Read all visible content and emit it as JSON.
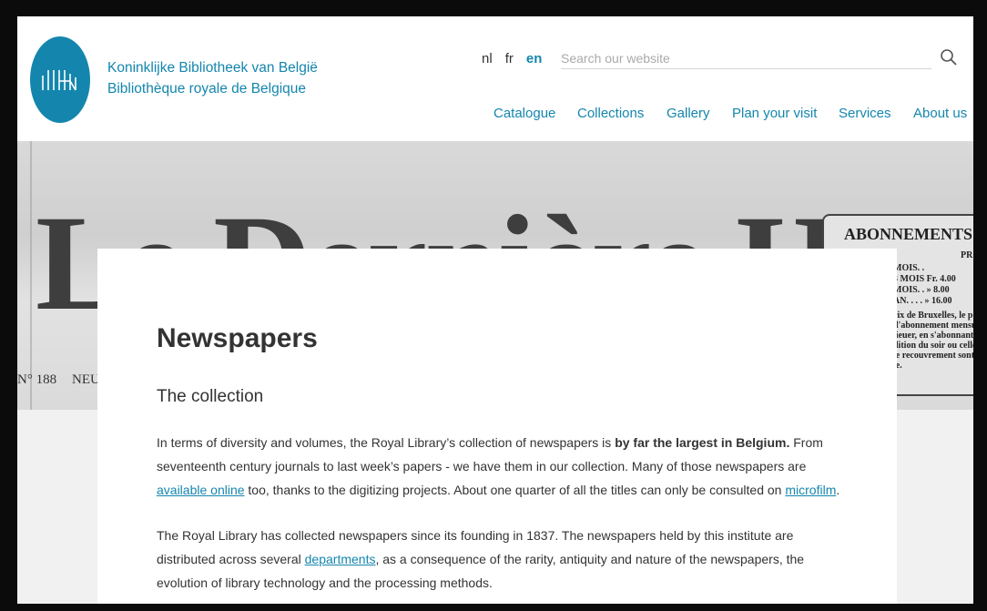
{
  "header": {
    "brand_nl": "Koninklijke Bibliotheek van België",
    "brand_fr": "Bibliothèque royale de Belgique",
    "languages": [
      "nl",
      "fr",
      "en"
    ],
    "active_language": "en",
    "search_placeholder": "Search our website",
    "nav": [
      "Catalogue",
      "Collections",
      "Gallery",
      "Plan your visit",
      "Services",
      "About us"
    ]
  },
  "hero": {
    "masthead": "Le Dernière Heure",
    "issue_no": "N° 188",
    "neu": "NEU",
    "abonnements_title": "ABONNEMENTS",
    "abonnements_lines": [
      "PROVINCE",
      "MOIS. .",
      "3 MOIS  Fr. 4.00",
      "MOIS. .  »  8.00",
      "AN. . . .  »  16.00",
      "rix de Bruxelles, le port",
      "d'abonnement mensuel.",
      "lieuer, en s'abonnant, si",
      "dition du soir ou celle du",
      "le recouvrement sont à",
      "le."
    ]
  },
  "content": {
    "title": "Newspapers",
    "subtitle": "The collection",
    "p1_a": "In terms of diversity and volumes, the Royal Library’s collection of newspapers is ",
    "p1_bold": "by far the largest in Belgium.",
    "p1_b": " From seventeenth century journals to last week’s papers - we have them in our collection. Many of those newspapers are ",
    "p1_link1": "available online",
    "p1_c": " too, thanks to the digitizing projects. About one quarter of all the titles can only be consulted on ",
    "p1_link2": "microfilm",
    "p1_d": ".",
    "p2_a": "The Royal Library has collected newspapers since its founding in 1837. The newspapers held by this institute are distributed across several ",
    "p2_link": "departments",
    "p2_b": ", as a consequence of the rarity, antiquity and nature of the newspapers, the evolution of library technology and the processing methods."
  },
  "colors": {
    "brand": "#1486ad"
  }
}
